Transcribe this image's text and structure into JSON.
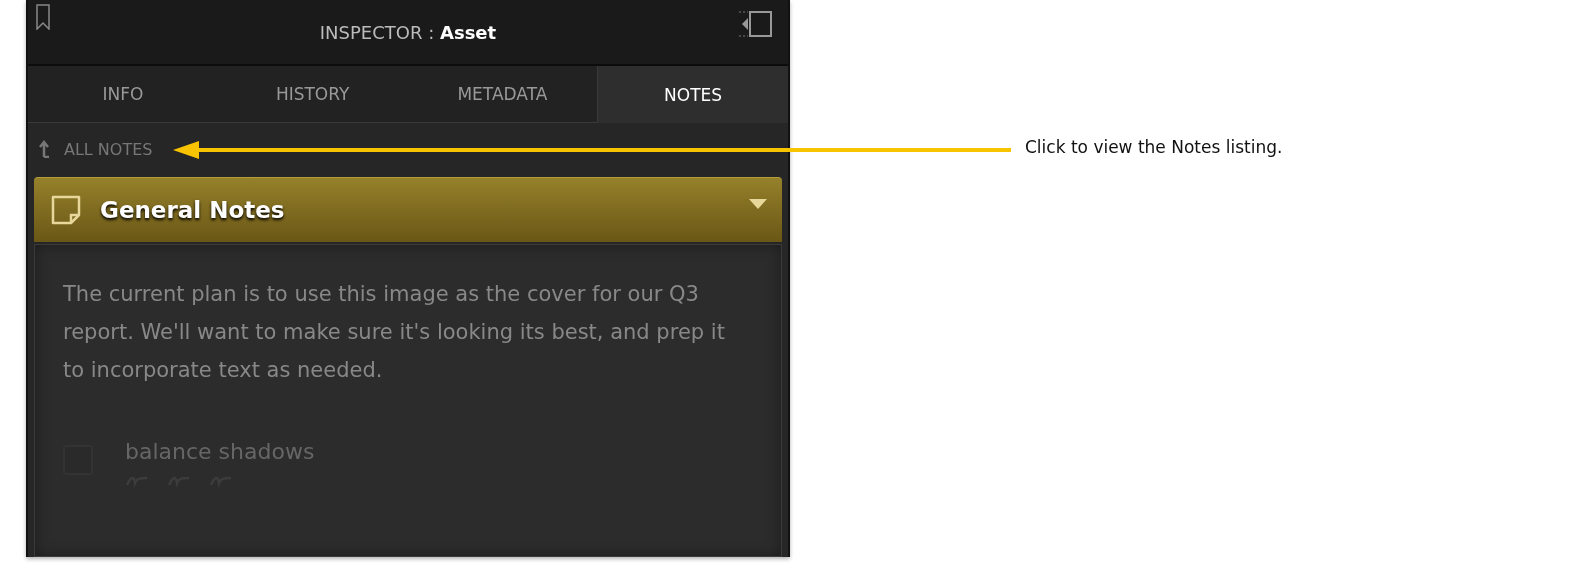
{
  "inspector": {
    "title_prefix": "INSPECTOR :",
    "title": "Asset"
  },
  "tabs": [
    {
      "label": "INFO",
      "selected": false
    },
    {
      "label": "HISTORY",
      "selected": false
    },
    {
      "label": "METADATA",
      "selected": false
    },
    {
      "label": "NOTES",
      "selected": true
    }
  ],
  "back_link": "ALL NOTES",
  "note": {
    "title": "General Notes",
    "expanded": true,
    "body": "The current plan is to use this image as the cover for our Q3 report. We'll want to make sure it's looking its best, and prep it to incorporate text as needed.",
    "checklist": [
      {
        "label": "balance shadows",
        "checked": false
      }
    ]
  },
  "callout": "Click to view the Notes listing."
}
